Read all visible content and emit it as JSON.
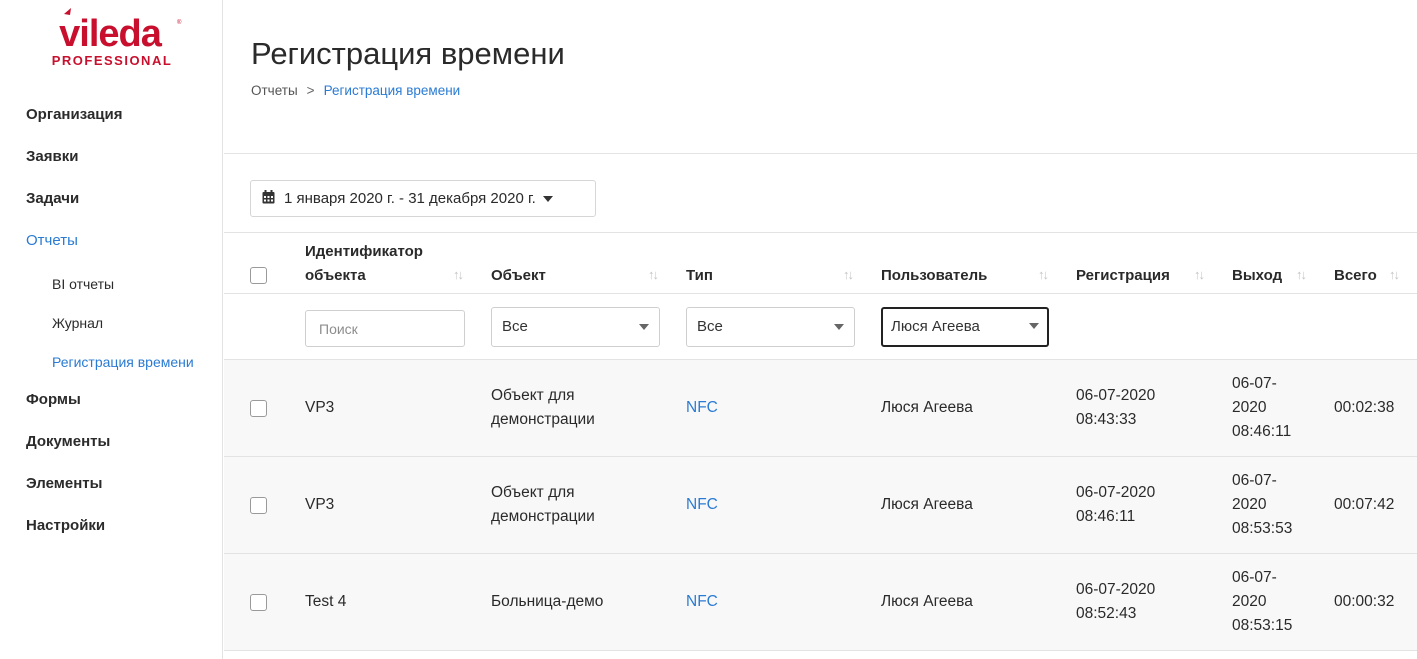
{
  "brand": {
    "name": "vileda",
    "sub": "PROFESSIONAL",
    "color": "#c8102e"
  },
  "sidebar": {
    "items": [
      {
        "label": "Организация"
      },
      {
        "label": "Заявки"
      },
      {
        "label": "Задачи"
      },
      {
        "label": "Отчеты",
        "active": true
      },
      {
        "label": "BI отчеты",
        "sub": true
      },
      {
        "label": "Журнал",
        "sub": true
      },
      {
        "label": "Регистрация времени",
        "sub": true,
        "active": true
      },
      {
        "label": "Формы"
      },
      {
        "label": "Документы"
      },
      {
        "label": "Элементы"
      },
      {
        "label": "Настройки"
      }
    ]
  },
  "page": {
    "title": "Регистрация времени",
    "breadcrumb": {
      "parent": "Отчеты",
      "separator": ">",
      "current": "Регистрация времени"
    }
  },
  "date_filter": {
    "label": "1 января 2020 г. - 31 декабря 2020 г.",
    "icon": "calendar-icon"
  },
  "table": {
    "columns": {
      "object_id": "Идентификатор объекта",
      "object_id_line1": "Идентификатор",
      "object_id_line2": "объекта",
      "object": "Объект",
      "type": "Тип",
      "user": "Пользователь",
      "checkin": "Регистрация",
      "checkout": "Выход",
      "total": "Всего"
    },
    "filters": {
      "search_placeholder": "Поиск",
      "object_value": "Все",
      "type_value": "Все",
      "user_value": "Люся Агеева"
    },
    "rows": [
      {
        "object_id": "VP3",
        "object_l1": "Объект для",
        "object_l2": "демонстрации",
        "type": "NFC",
        "user": "Люся Агеева",
        "checkin_date": "06-07-2020",
        "checkin_time": "08:43:33",
        "checkout_l1": "06-07-",
        "checkout_l2": "2020",
        "checkout_l3": "08:46:11",
        "total": "00:02:38"
      },
      {
        "object_id": "VP3",
        "object_l1": "Объект для",
        "object_l2": "демонстрации",
        "type": "NFC",
        "user": "Люся Агеева",
        "checkin_date": "06-07-2020",
        "checkin_time": "08:46:11",
        "checkout_l1": "06-07-",
        "checkout_l2": "2020",
        "checkout_l3": "08:53:53",
        "total": "00:07:42"
      },
      {
        "object_id": "Test 4",
        "object_l1": "Больница-демо",
        "object_l2": "",
        "type": "NFC",
        "user": "Люся Агеева",
        "checkin_date": "06-07-2020",
        "checkin_time": "08:52:43",
        "checkout_l1": "06-07-",
        "checkout_l2": "2020",
        "checkout_l3": "08:53:15",
        "total": "00:00:32"
      }
    ]
  },
  "colors": {
    "accent": "#2a7bd3",
    "row_bg": "#f8f8f8",
    "border": "#e3e3e3"
  }
}
